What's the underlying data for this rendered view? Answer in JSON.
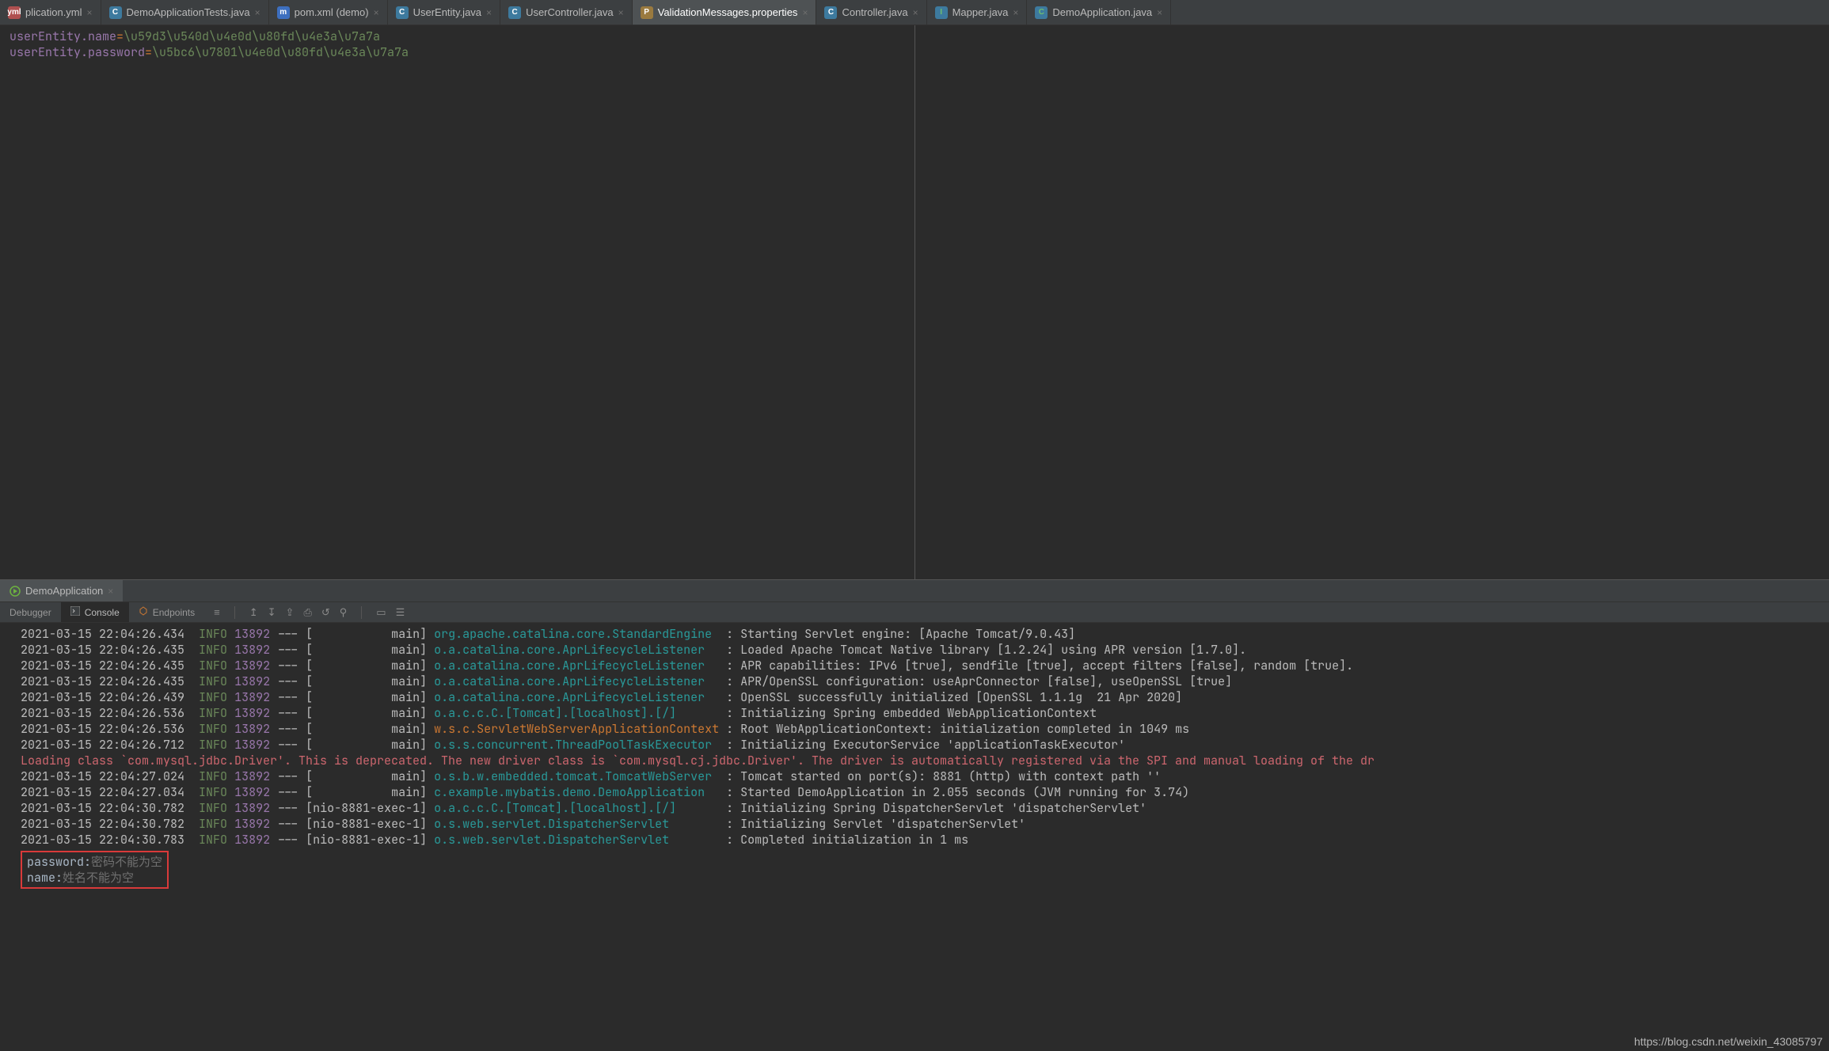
{
  "tabs": [
    {
      "icon": "yml",
      "icon_bg": "#b05050",
      "icon_fg": "#ffffff",
      "label": "plication.yml",
      "active": false
    },
    {
      "icon": "C",
      "icon_bg": "#3d7a9e",
      "icon_fg": "#ffffff",
      "label": "DemoApplicationTests.java",
      "active": false
    },
    {
      "icon": "m",
      "icon_bg": "#3d6fbf",
      "icon_fg": "#ffffff",
      "label": "pom.xml (demo)",
      "active": false
    },
    {
      "icon": "C",
      "icon_bg": "#3d7a9e",
      "icon_fg": "#ffffff",
      "label": "UserEntity.java",
      "active": false
    },
    {
      "icon": "C",
      "icon_bg": "#3d7a9e",
      "icon_fg": "#ffffff",
      "label": "UserController.java",
      "active": false
    },
    {
      "icon": "P",
      "icon_bg": "#9a7a3f",
      "icon_fg": "#ffffff",
      "label": "ValidationMessages.properties",
      "active": true
    },
    {
      "icon": "C",
      "icon_bg": "#3d7a9e",
      "icon_fg": "#ffffff",
      "label": "Controller.java",
      "active": false
    },
    {
      "icon": "I",
      "icon_bg": "#3d7a9e",
      "icon_fg": "#6fbf6f",
      "label": "Mapper.java",
      "active": false
    },
    {
      "icon": "C",
      "icon_bg": "#3d7a9e",
      "icon_fg": "#6fbf6f",
      "label": "DemoApplication.java",
      "active": false
    }
  ],
  "editor": {
    "line1_key": "userEntity.name",
    "line1_eq": "=",
    "line1_val": "\\u59d3\\u540d\\u4e0d\\u80fd\\u4e3a\\u7a7a",
    "line2_key": "userEntity.password",
    "line2_eq": "=",
    "line2_val": "\\u5bc6\\u7801\\u4e0d\\u80fd\\u4e3a\\u7a7a"
  },
  "run_tab": {
    "label": "DemoApplication"
  },
  "tool_tabs": {
    "debugger": "Debugger",
    "console": "Console",
    "endpoints": "Endpoints"
  },
  "log_lines": [
    {
      "ts": "2021-03-15 22:04:26.434",
      "level": "INFO",
      "pid": "13892",
      "th": "[           main]",
      "logger": "org.apache.catalina.core.StandardEngine ",
      "color": "cyan",
      "msg": ": Starting Servlet engine: [Apache Tomcat/9.0.43]"
    },
    {
      "ts": "2021-03-15 22:04:26.435",
      "level": "INFO",
      "pid": "13892",
      "th": "[           main]",
      "logger": "o.a.catalina.core.AprLifecycleListener  ",
      "color": "cyan",
      "msg": ": Loaded Apache Tomcat Native library [1.2.24] using APR version [1.7.0]."
    },
    {
      "ts": "2021-03-15 22:04:26.435",
      "level": "INFO",
      "pid": "13892",
      "th": "[           main]",
      "logger": "o.a.catalina.core.AprLifecycleListener  ",
      "color": "cyan",
      "msg": ": APR capabilities: IPv6 [true], sendfile [true], accept filters [false], random [true]."
    },
    {
      "ts": "2021-03-15 22:04:26.435",
      "level": "INFO",
      "pid": "13892",
      "th": "[           main]",
      "logger": "o.a.catalina.core.AprLifecycleListener  ",
      "color": "cyan",
      "msg": ": APR/OpenSSL configuration: useAprConnector [false], useOpenSSL [true]"
    },
    {
      "ts": "2021-03-15 22:04:26.439",
      "level": "INFO",
      "pid": "13892",
      "th": "[           main]",
      "logger": "o.a.catalina.core.AprLifecycleListener  ",
      "color": "cyan",
      "msg": ": OpenSSL successfully initialized [OpenSSL 1.1.1g  21 Apr 2020]"
    },
    {
      "ts": "2021-03-15 22:04:26.536",
      "level": "INFO",
      "pid": "13892",
      "th": "[           main]",
      "logger": "o.a.c.c.C.[Tomcat].[localhost].[/]      ",
      "color": "cyan",
      "msg": ": Initializing Spring embedded WebApplicationContext"
    },
    {
      "ts": "2021-03-15 22:04:26.536",
      "level": "INFO",
      "pid": "13892",
      "th": "[           main]",
      "logger": "w.s.c.ServletWebServerApplicationContext",
      "color": "orange",
      "msg": ": Root WebApplicationContext: initialization completed in 1049 ms"
    },
    {
      "ts": "2021-03-15 22:04:26.712",
      "level": "INFO",
      "pid": "13892",
      "th": "[           main]",
      "logger": "o.s.s.concurrent.ThreadPoolTaskExecutor ",
      "color": "cyan",
      "msg": ": Initializing ExecutorService 'applicationTaskExecutor'"
    }
  ],
  "warn_line": "Loading class `com.mysql.jdbc.Driver'. This is deprecated. The new driver class is `com.mysql.cj.jdbc.Driver'. The driver is automatically registered via the SPI and manual loading of the dr",
  "log_lines2": [
    {
      "ts": "2021-03-15 22:04:27.024",
      "level": "INFO",
      "pid": "13892",
      "th": "[           main]",
      "logger": "o.s.b.w.embedded.tomcat.TomcatWebServer ",
      "color": "cyan",
      "msg": ": Tomcat started on port(s): 8881 (http) with context path ''"
    },
    {
      "ts": "2021-03-15 22:04:27.034",
      "level": "INFO",
      "pid": "13892",
      "th": "[           main]",
      "logger": "c.example.mybatis.demo.DemoApplication  ",
      "color": "cyan",
      "msg": ": Started DemoApplication in 2.055 seconds (JVM running for 3.74)"
    },
    {
      "ts": "2021-03-15 22:04:30.782",
      "level": "INFO",
      "pid": "13892",
      "th": "[nio-8881-exec-1]",
      "logger": "o.a.c.c.C.[Tomcat].[localhost].[/]      ",
      "color": "cyan",
      "msg": ": Initializing Spring DispatcherServlet 'dispatcherServlet'"
    },
    {
      "ts": "2021-03-15 22:04:30.782",
      "level": "INFO",
      "pid": "13892",
      "th": "[nio-8881-exec-1]",
      "logger": "o.s.web.servlet.DispatcherServlet       ",
      "color": "cyan",
      "msg": ": Initializing Servlet 'dispatcherServlet'"
    },
    {
      "ts": "2021-03-15 22:04:30.783",
      "level": "INFO",
      "pid": "13892",
      "th": "[nio-8881-exec-1]",
      "logger": "o.s.web.servlet.DispatcherServlet       ",
      "color": "cyan",
      "msg": ": Completed initialization in 1 ms"
    }
  ],
  "output_box": {
    "line1_key": "password:",
    "line1_cn": "密码不能为空",
    "line2_key": "name:",
    "line2_cn": "姓名不能为空"
  },
  "watermark": "https://blog.csdn.net/weixin_43085797"
}
